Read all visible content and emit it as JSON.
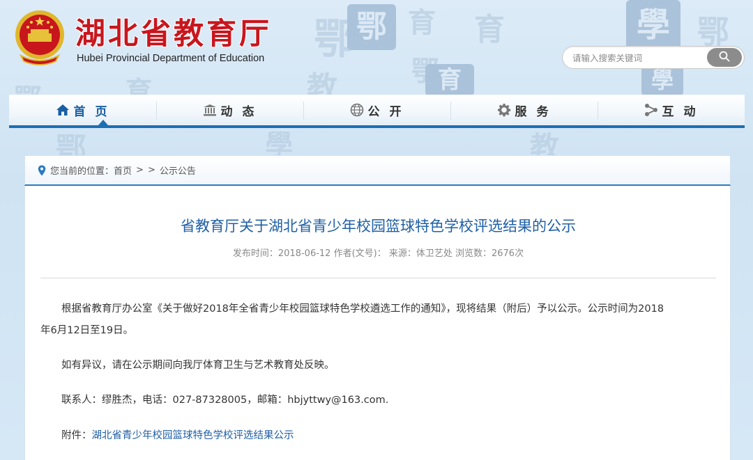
{
  "header": {
    "title": "湖北省教育厅",
    "subtitle": "Hubei Provincial Department of Education",
    "emblem_icon": "national-emblem-icon",
    "search": {
      "placeholder": "请输入搜索关键词",
      "button_icon": "search-icon"
    }
  },
  "nav": {
    "items": [
      {
        "label": "首 页",
        "icon": "home-icon",
        "active": true
      },
      {
        "label": "动 态",
        "icon": "building-icon",
        "active": false
      },
      {
        "label": "公 开",
        "icon": "globe-icon",
        "active": false
      },
      {
        "label": "服 务",
        "icon": "gear-icon",
        "active": false
      },
      {
        "label": "互 动",
        "icon": "share-icon",
        "active": false
      }
    ],
    "active_color": "#1a5fa3",
    "bar_color": "#1c6fb3"
  },
  "breadcrumb": {
    "prefix": "您当前的位置：",
    "home": "首页",
    "sep1": ">",
    "sep2": ">",
    "current": "公示公告"
  },
  "article": {
    "title": "省教育厅关于湖北省青少年校园篮球特色学校评选结果的公示",
    "meta": "发布时间：2018-06-12 作者(文号)： 来源：体卫艺处 浏览数：2676次",
    "paragraphs": [
      "根据省教育厅办公室《关于做好2018年全省青少年校园篮球特色学校遴选工作的通知》，现将结果（附后）予以公示。公示时间为2018",
      "年6月12日至19日。",
      "如有异议，请在公示期间向我厅体育卫生与艺术教育处反映。",
      "联系人：缪胜杰，电话：027-87328005，邮箱：hbjyttwy@163.com."
    ],
    "attachment_label": "附件：",
    "attachment_link": "湖北省青少年校园篮球特色学校评选结果公示"
  },
  "background": {
    "seal_chars": [
      "鄂",
      "育",
      "鄂",
      "學",
      "鄂",
      "育",
      "教",
      "學"
    ]
  }
}
